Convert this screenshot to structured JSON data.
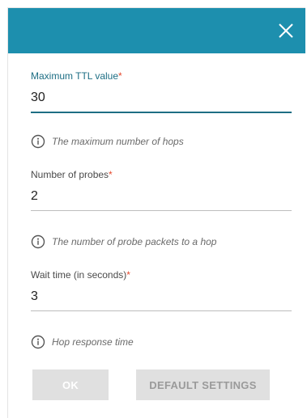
{
  "dialog": {
    "close_icon": "close-icon"
  },
  "fields": {
    "max_ttl": {
      "label": "Maximum TTL value",
      "required_mark": "*",
      "value": "30",
      "hint": "The maximum number of hops"
    },
    "probes": {
      "label": "Number of probes",
      "required_mark": "*",
      "value": "2",
      "hint": "The number of probe packets to a hop"
    },
    "wait_time": {
      "label": "Wait time (in seconds)",
      "required_mark": "*",
      "value": "3",
      "hint": "Hop response time"
    }
  },
  "actions": {
    "ok_label": "OK",
    "default_label": "DEFAULT SETTINGS"
  },
  "colors": {
    "header": "#1d8fae",
    "active_field": "#1d6e84",
    "required": "#e5482d",
    "button_disabled": "#e0e0e0"
  }
}
